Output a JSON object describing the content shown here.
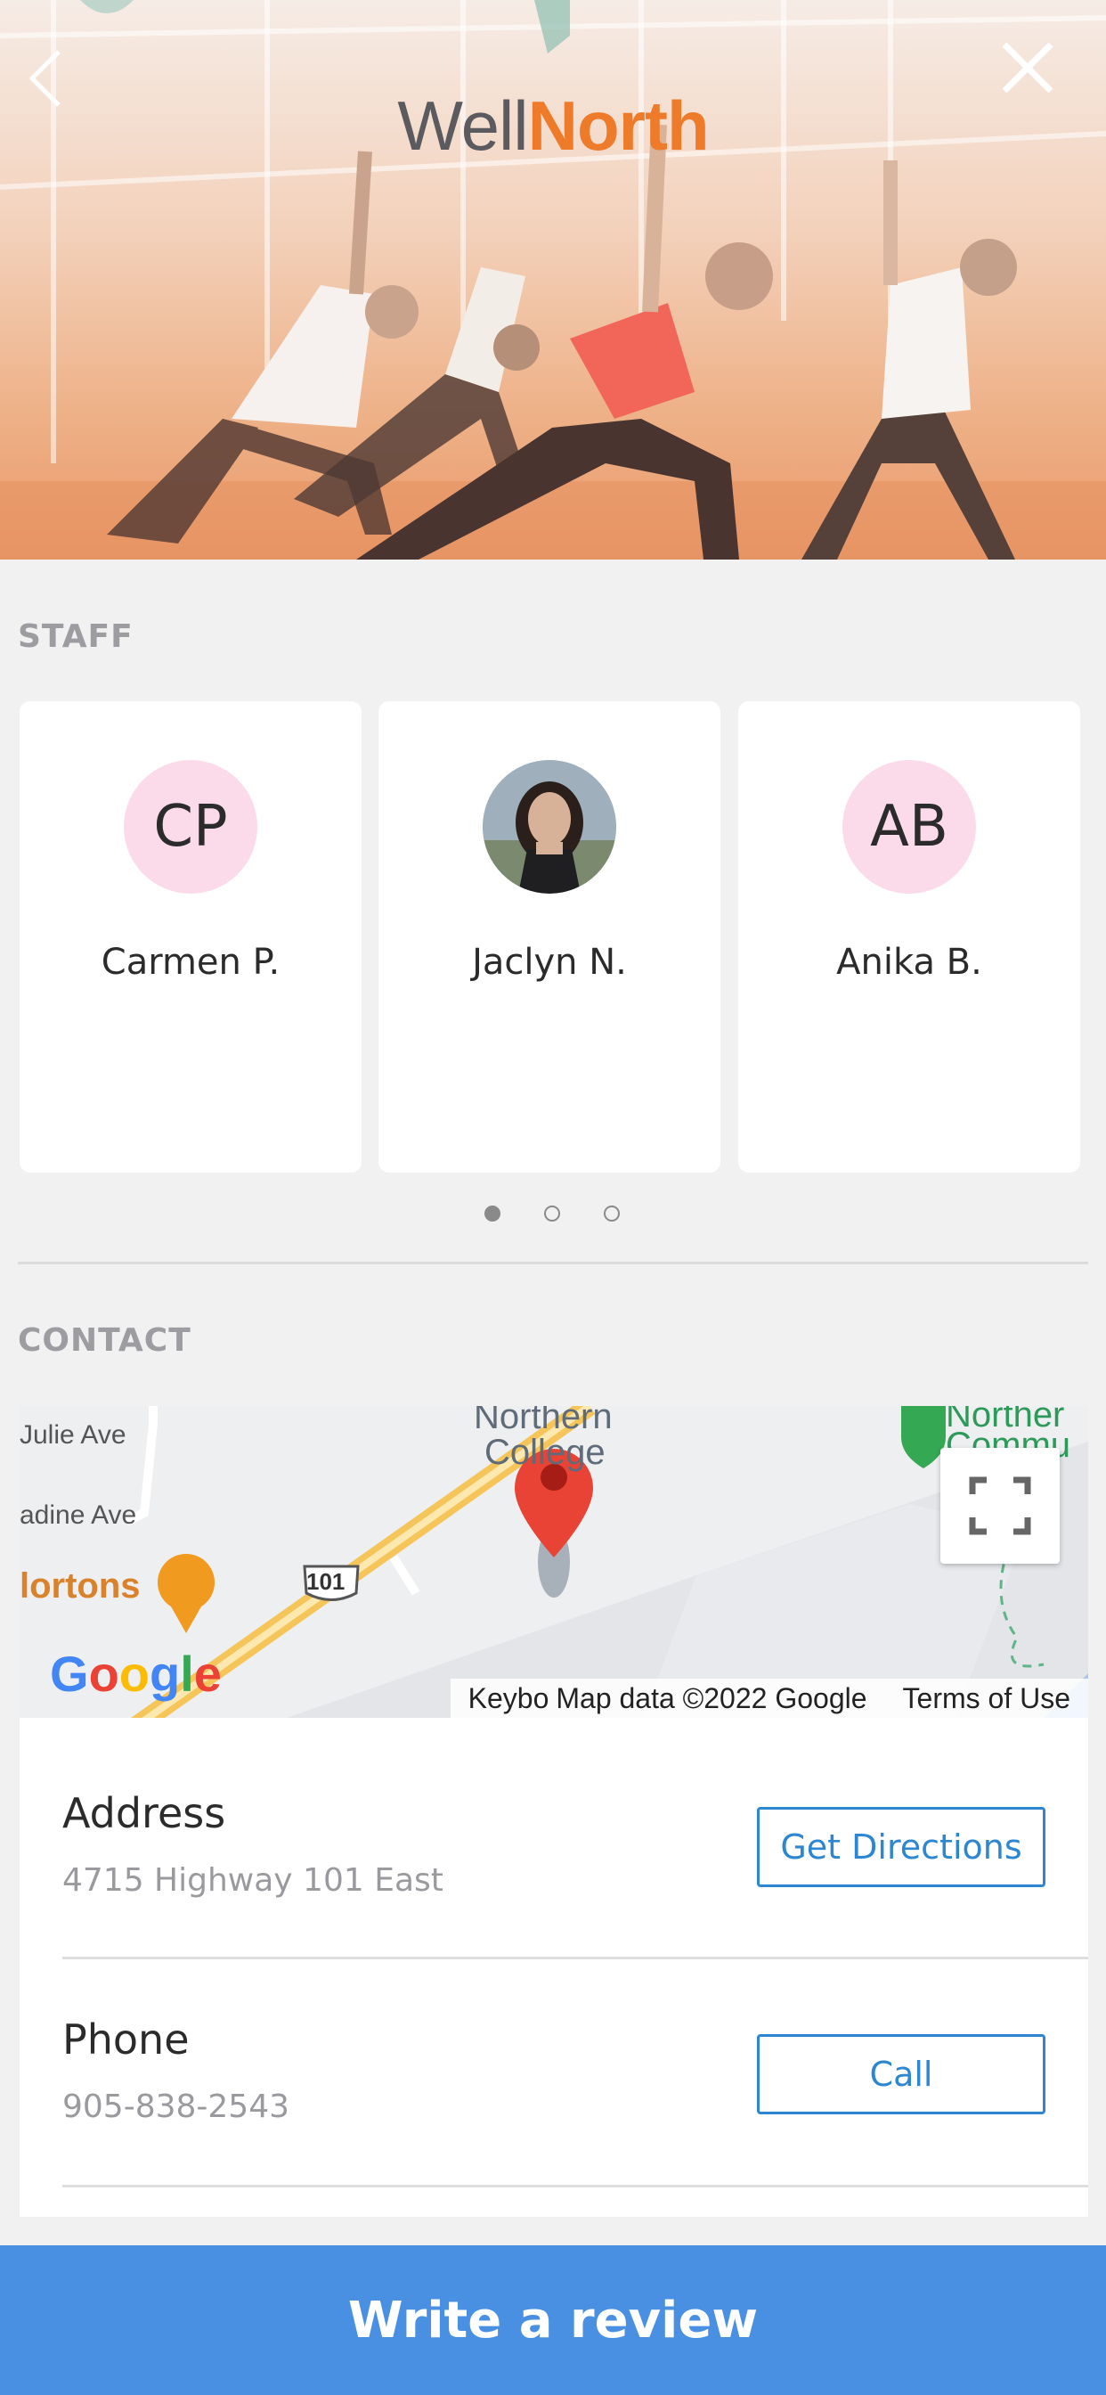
{
  "header": {
    "logo_part1": "Well",
    "logo_part2": "North",
    "back_icon": "chevron-left-icon",
    "close_icon": "close-icon"
  },
  "staff": {
    "title": "STAFF",
    "members": [
      {
        "initials": "CP",
        "name": "Carmen P."
      },
      {
        "initials": "",
        "name": "Jaclyn N."
      },
      {
        "initials": "AB",
        "name": "Anika B."
      }
    ],
    "pagination": {
      "pages": 3,
      "current": 1
    }
  },
  "contact": {
    "title": "CONTACT",
    "map": {
      "labels": {
        "julie": "Julie Ave",
        "adine": "adine Ave",
        "nortons": "lortons",
        "route": "101",
        "college_1": "Northern",
        "college_2": "College",
        "community_1": "Norther",
        "community_2": "Commu",
        "google": "Google",
        "keyboard": "Keybo",
        "map_data": "Map data ©2022 Google",
        "terms": "Terms of Use"
      }
    },
    "address": {
      "label": "Address",
      "value": "4715 Highway 101 East",
      "button": "Get Directions"
    },
    "phone": {
      "label": "Phone",
      "value": "905-838-2543",
      "button": "Call"
    }
  },
  "footer": {
    "review_button": "Write a review"
  },
  "colors": {
    "brand_orange": "#ee7b2a",
    "brand_gray": "#5a5a5f",
    "accent_blue": "#4a90e2",
    "link_blue": "#2d86d1",
    "avatar_pink": "#fbdbe9"
  }
}
